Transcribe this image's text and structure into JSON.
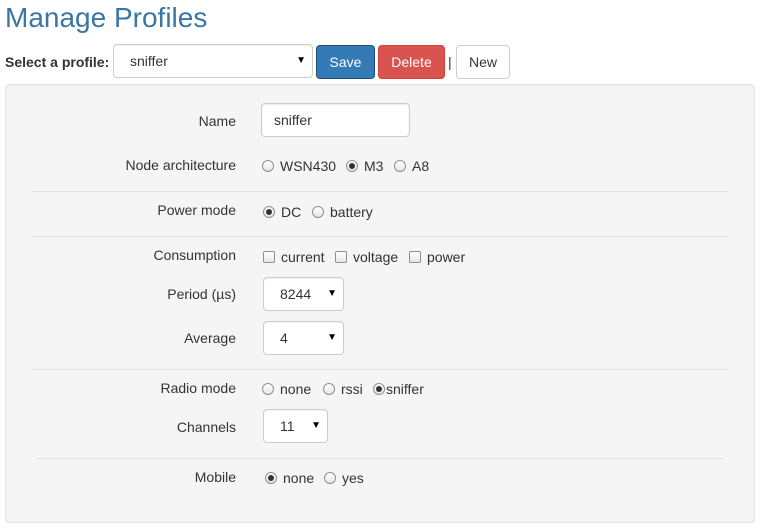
{
  "page": {
    "title": "Manage Profiles"
  },
  "toolbar": {
    "select_label": "Select a profile:",
    "selected_profile": "sniffer",
    "save_label": "Save",
    "delete_label": "Delete",
    "separator": "|",
    "new_label": "New"
  },
  "form": {
    "name": {
      "label": "Name",
      "value": "sniffer"
    },
    "node_architecture": {
      "label": "Node architecture",
      "options": [
        "WSN430",
        "M3",
        "A8"
      ],
      "selected": "M3"
    },
    "power_mode": {
      "label": "Power mode",
      "options": [
        "DC",
        "battery"
      ],
      "selected": "DC"
    },
    "consumption": {
      "label": "Consumption",
      "options": [
        "current",
        "voltage",
        "power"
      ],
      "checked": []
    },
    "period": {
      "label": "Period (µs)",
      "value": "8244"
    },
    "average": {
      "label": "Average",
      "value": "4"
    },
    "radio_mode": {
      "label": "Radio mode",
      "options": [
        "none",
        "rssi",
        "sniffer"
      ],
      "selected": "sniffer"
    },
    "channels": {
      "label": "Channels",
      "value": "11"
    },
    "mobile": {
      "label": "Mobile",
      "options": [
        "none",
        "yes"
      ],
      "selected": "none"
    }
  },
  "colors": {
    "title": "#3a76a5",
    "save_button": "#337ab7",
    "delete_button": "#d9534f",
    "panel_bg": "#f5f5f5"
  },
  "icons": {
    "dropdown": "caret-down-icon"
  }
}
